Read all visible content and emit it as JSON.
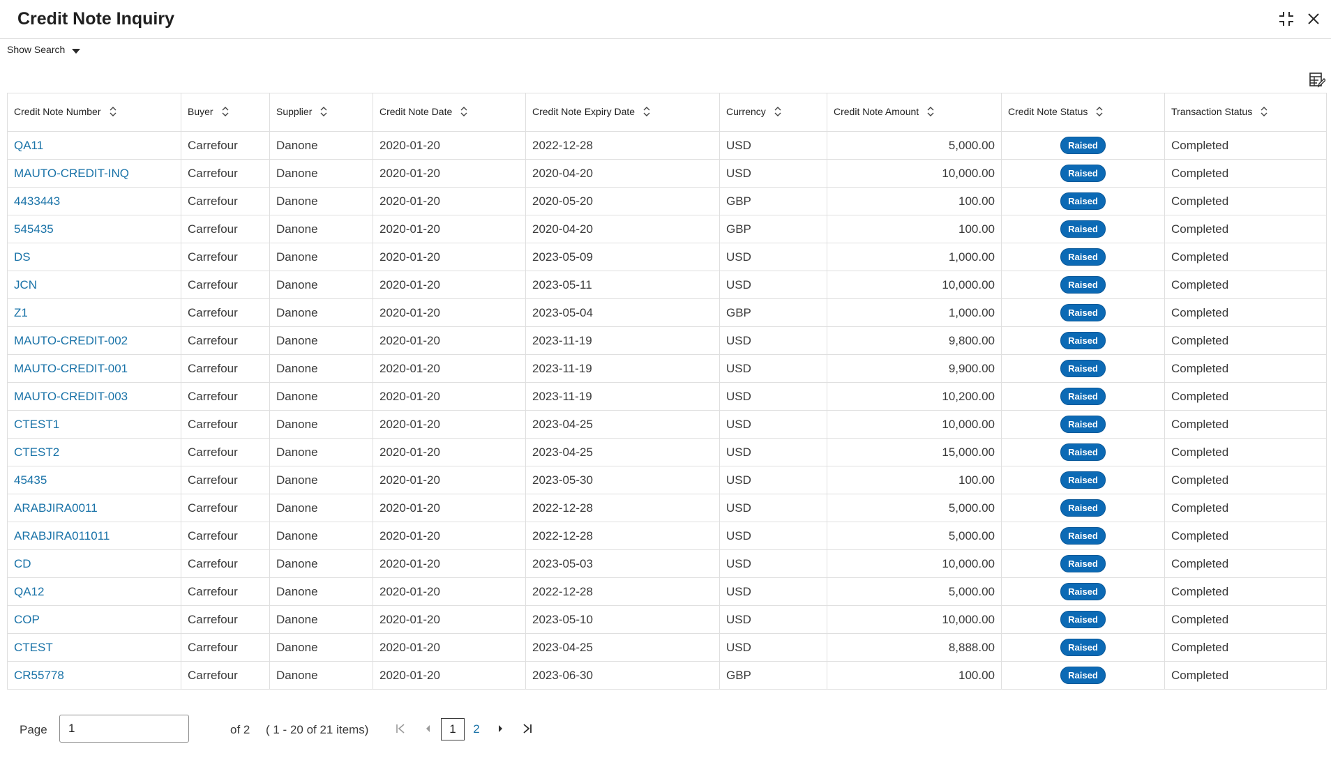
{
  "window": {
    "title": "Credit Note Inquiry"
  },
  "search": {
    "toggle_label": "Show Search"
  },
  "table": {
    "columns": [
      "Credit Note Number",
      "Buyer",
      "Supplier",
      "Credit Note Date",
      "Credit Note Expiry Date",
      "Currency",
      "Credit Note Amount",
      "Credit Note Status",
      "Transaction Status"
    ],
    "rows": [
      [
        "QA11",
        "Carrefour",
        "Danone",
        "2020-01-20",
        "2022-12-28",
        "USD",
        "5,000.00",
        "Raised",
        "Completed"
      ],
      [
        "MAUTO-CREDIT-INQ",
        "Carrefour",
        "Danone",
        "2020-01-20",
        "2020-04-20",
        "USD",
        "10,000.00",
        "Raised",
        "Completed"
      ],
      [
        "4433443",
        "Carrefour",
        "Danone",
        "2020-01-20",
        "2020-05-20",
        "GBP",
        "100.00",
        "Raised",
        "Completed"
      ],
      [
        "545435",
        "Carrefour",
        "Danone",
        "2020-01-20",
        "2020-04-20",
        "GBP",
        "100.00",
        "Raised",
        "Completed"
      ],
      [
        "DS",
        "Carrefour",
        "Danone",
        "2020-01-20",
        "2023-05-09",
        "USD",
        "1,000.00",
        "Raised",
        "Completed"
      ],
      [
        "JCN",
        "Carrefour",
        "Danone",
        "2020-01-20",
        "2023-05-11",
        "USD",
        "10,000.00",
        "Raised",
        "Completed"
      ],
      [
        "Z1",
        "Carrefour",
        "Danone",
        "2020-01-20",
        "2023-05-04",
        "GBP",
        "1,000.00",
        "Raised",
        "Completed"
      ],
      [
        "MAUTO-CREDIT-002",
        "Carrefour",
        "Danone",
        "2020-01-20",
        "2023-11-19",
        "USD",
        "9,800.00",
        "Raised",
        "Completed"
      ],
      [
        "MAUTO-CREDIT-001",
        "Carrefour",
        "Danone",
        "2020-01-20",
        "2023-11-19",
        "USD",
        "9,900.00",
        "Raised",
        "Completed"
      ],
      [
        "MAUTO-CREDIT-003",
        "Carrefour",
        "Danone",
        "2020-01-20",
        "2023-11-19",
        "USD",
        "10,200.00",
        "Raised",
        "Completed"
      ],
      [
        "CTEST1",
        "Carrefour",
        "Danone",
        "2020-01-20",
        "2023-04-25",
        "USD",
        "10,000.00",
        "Raised",
        "Completed"
      ],
      [
        "CTEST2",
        "Carrefour",
        "Danone",
        "2020-01-20",
        "2023-04-25",
        "USD",
        "15,000.00",
        "Raised",
        "Completed"
      ],
      [
        "45435",
        "Carrefour",
        "Danone",
        "2020-01-20",
        "2023-05-30",
        "USD",
        "100.00",
        "Raised",
        "Completed"
      ],
      [
        "ARABJIRA0011",
        "Carrefour",
        "Danone",
        "2020-01-20",
        "2022-12-28",
        "USD",
        "5,000.00",
        "Raised",
        "Completed"
      ],
      [
        "ARABJIRA011011",
        "Carrefour",
        "Danone",
        "2020-01-20",
        "2022-12-28",
        "USD",
        "5,000.00",
        "Raised",
        "Completed"
      ],
      [
        "CD",
        "Carrefour",
        "Danone",
        "2020-01-20",
        "2023-05-03",
        "USD",
        "10,000.00",
        "Raised",
        "Completed"
      ],
      [
        "QA12",
        "Carrefour",
        "Danone",
        "2020-01-20",
        "2022-12-28",
        "USD",
        "5,000.00",
        "Raised",
        "Completed"
      ],
      [
        "COP",
        "Carrefour",
        "Danone",
        "2020-01-20",
        "2023-05-10",
        "USD",
        "10,000.00",
        "Raised",
        "Completed"
      ],
      [
        "CTEST",
        "Carrefour",
        "Danone",
        "2020-01-20",
        "2023-04-25",
        "USD",
        "8,888.00",
        "Raised",
        "Completed"
      ],
      [
        "CR55778",
        "Carrefour",
        "Danone",
        "2020-01-20",
        "2023-06-30",
        "GBP",
        "100.00",
        "Raised",
        "Completed"
      ]
    ]
  },
  "pagination": {
    "page_label": "Page",
    "page_value": "1",
    "of_total": "of 2",
    "items_range": "( 1 - 20 of 21 items)",
    "pages": [
      "1",
      "2"
    ]
  },
  "colors": {
    "link": "#1a73a8",
    "badge": "#0c6ab5",
    "border": "#dfdfdf"
  },
  "icons": [
    "minimize-icon",
    "close-icon",
    "caret-down-icon",
    "column-settings-icon",
    "sort-icon",
    "first-page-icon",
    "previous-page-icon",
    "next-page-icon",
    "last-page-icon"
  ]
}
